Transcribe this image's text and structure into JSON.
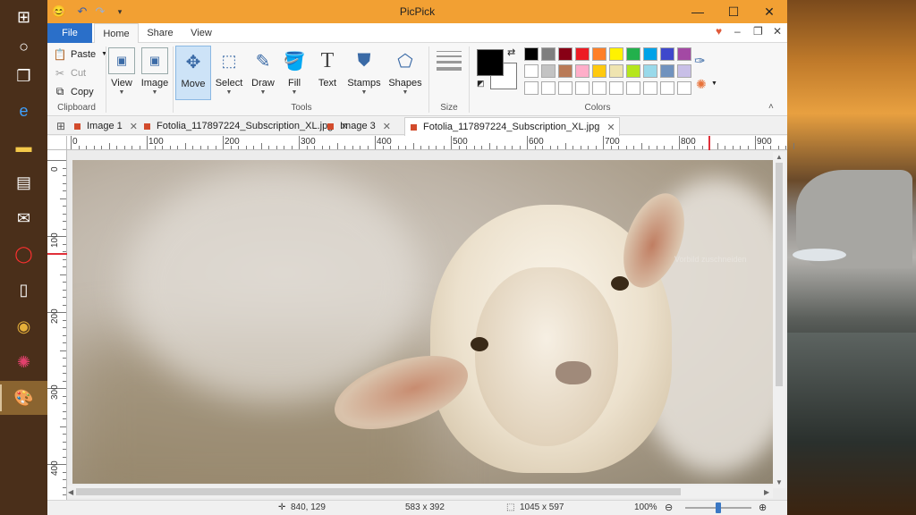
{
  "app": {
    "title": "PicPick"
  },
  "colors": {
    "titlebar": "#f2a033",
    "file_tab": "#2a6fc9",
    "accent": "#3b78c4"
  },
  "taskbar": {
    "items": [
      {
        "name": "windows-start-icon"
      },
      {
        "name": "cortana-icon"
      },
      {
        "name": "task-view-icon"
      },
      {
        "name": "edge-icon"
      },
      {
        "name": "file-explorer-icon"
      },
      {
        "name": "store-icon"
      },
      {
        "name": "mail-icon"
      },
      {
        "name": "opera-icon"
      },
      {
        "name": "document-icon"
      },
      {
        "name": "chrome-icon"
      },
      {
        "name": "color-wheel-icon"
      },
      {
        "name": "picpick-icon"
      }
    ]
  },
  "ribbon_tabs": {
    "file": "File",
    "home": "Home",
    "share": "Share",
    "view": "View"
  },
  "clipboard": {
    "paste": "Paste",
    "cut": "Cut",
    "copy": "Copy",
    "label": "Clipboard"
  },
  "view_group": {
    "view": "View",
    "image": "Image"
  },
  "tools": {
    "label": "Tools",
    "items": [
      {
        "label": "Move",
        "icon": "move-icon"
      },
      {
        "label": "Select",
        "icon": "select-icon"
      },
      {
        "label": "Draw",
        "icon": "pen-icon"
      },
      {
        "label": "Fill",
        "icon": "fill-bucket-icon"
      },
      {
        "label": "Text",
        "icon": "text-icon"
      },
      {
        "label": "Stamps",
        "icon": "stamp-icon"
      },
      {
        "label": "Shapes",
        "icon": "shapes-icon"
      }
    ]
  },
  "size_group": {
    "label": "Size"
  },
  "colors_group": {
    "label": "Colors",
    "primary": "#000000",
    "secondary": "#ffffff",
    "palette_row1": [
      "#000000",
      "#7f7f7f",
      "#880015",
      "#ed1c24",
      "#ff7f27",
      "#fff200",
      "#22b14c",
      "#00a2e8",
      "#3f48cc",
      "#a349a4"
    ],
    "palette_row2": [
      "#ffffff",
      "#c3c3c3",
      "#b97a57",
      "#ffaec9",
      "#ffc90e",
      "#efe4b0",
      "#b5e61d",
      "#99d9ea",
      "#7092be",
      "#c8bfe7"
    ],
    "palette_row3": [
      "#ffffff",
      "#ffffff",
      "#ffffff",
      "#ffffff",
      "#ffffff",
      "#ffffff",
      "#ffffff",
      "#ffffff",
      "#ffffff",
      "#ffffff"
    ]
  },
  "doc_tabs": [
    {
      "label": "Image 1"
    },
    {
      "label": "Fotolia_117897224_Subscription_XL.jpg"
    },
    {
      "label": "Image 3"
    },
    {
      "label": "Fotolia_117897224_Subscription_XL.jpg"
    }
  ],
  "ruler_h": [
    "0",
    "100",
    "200",
    "300",
    "400",
    "500",
    "600",
    "700",
    "800",
    "900"
  ],
  "ruler_v": [
    "0",
    "100",
    "200",
    "300",
    "400"
  ],
  "canvas": {
    "overlay_text": "Vorbild zuschneiden"
  },
  "status": {
    "cursor": "840, 129",
    "selection": "583 x 392",
    "image_size": "1045 x 597",
    "zoom": "100%"
  }
}
